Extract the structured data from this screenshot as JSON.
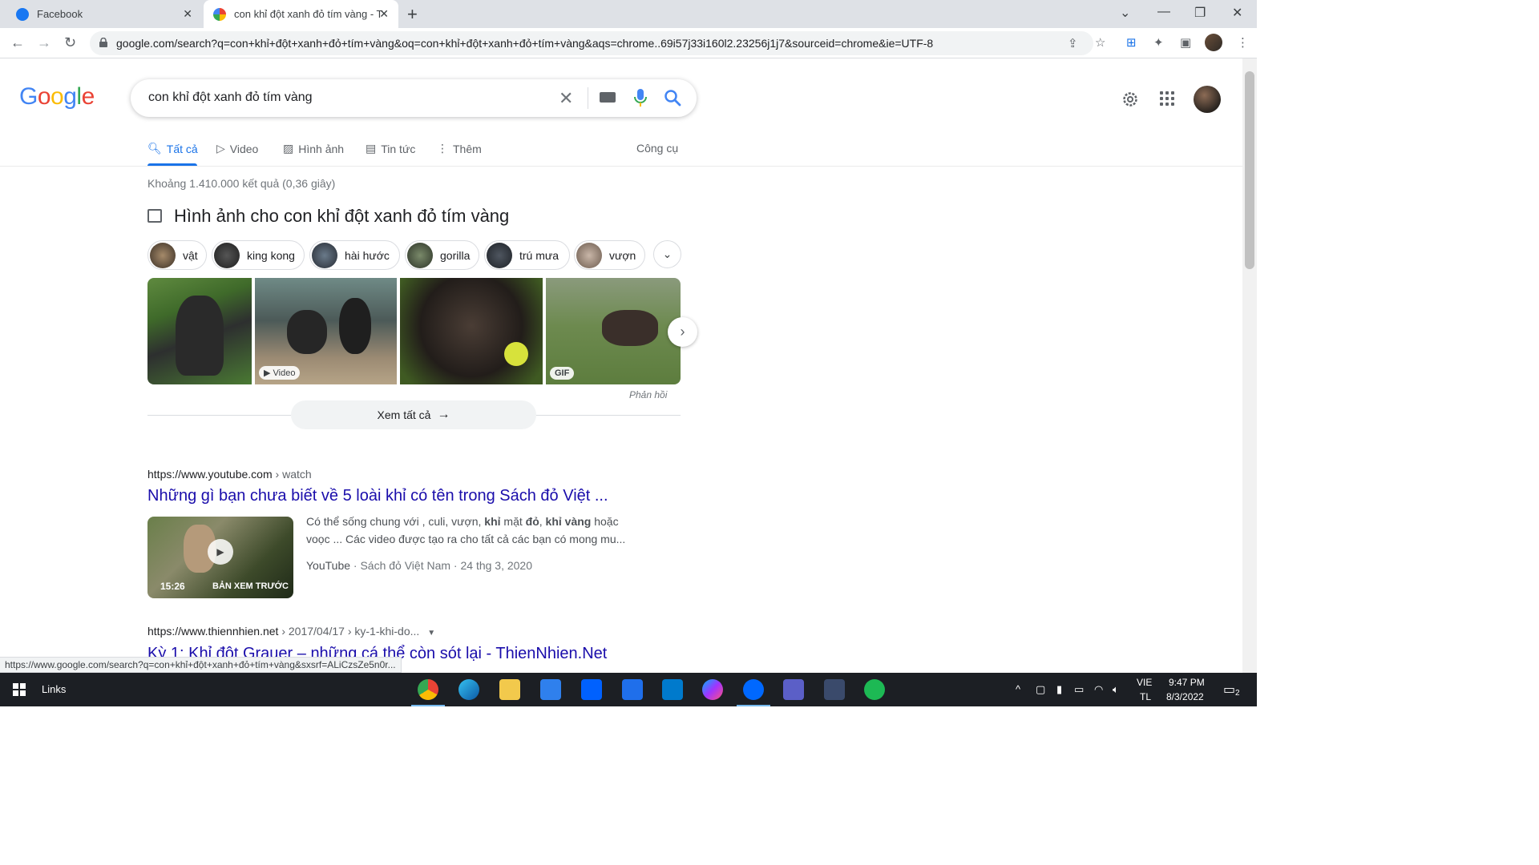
{
  "browser": {
    "tabs": [
      {
        "title": "Facebook",
        "favicon_color": "#1877f2"
      },
      {
        "title": "con khỉ đột xanh đỏ tím vàng - T",
        "favicon_color": "#4285f4"
      }
    ],
    "url": "google.com/search?q=con+khỉ+đột+xanh+đỏ+tím+vàng&oq=con+khỉ+đột+xanh+đỏ+tím+vàng&aqs=chrome..69i57j33i160l2.23256j1j7&sourceid=chrome&ie=UTF-8",
    "status_url": "https://www.google.com/search?q=con+khỉ+đột+xanh+đỏ+tím+vàng&sxsrf=ALiCzsZe5n0r..."
  },
  "google": {
    "logo": [
      "G",
      "o",
      "o",
      "g",
      "l",
      "e"
    ],
    "query": "con khỉ đột xanh đỏ tím vàng",
    "nav_tabs": [
      "Tất cả",
      "Video",
      "Hình ảnh",
      "Tin tức",
      "Thêm"
    ],
    "tools": "Công cụ",
    "stats": "Khoảng 1.410.000 kết quả (0,36 giây)",
    "images_header": "Hình ảnh cho con khỉ đột xanh đỏ tím vàng",
    "chips": [
      "vật",
      "king kong",
      "hài hước",
      "gorilla",
      "trú mưa",
      "vượn"
    ],
    "image_badges": {
      "video": "Video",
      "gif": "GIF"
    },
    "feedback": "Phản hồi",
    "see_all": "Xem tất cả"
  },
  "results": [
    {
      "cite_domain": "https://www.youtube.com",
      "cite_path": " › watch",
      "title": "Những gì bạn chưa biết về 5 loài khỉ có tên trong Sách đỏ Việt ...",
      "snippet_line1_a": "Có thể sống chung với , culi, vượn, ",
      "snippet_b1": "khỉ",
      "snippet_line1_c": " mặt ",
      "snippet_b2": "đỏ",
      "snippet_line1_d": ", ",
      "snippet_b3": "khỉ vàng",
      "snippet_line1_e": " hoặc",
      "snippet_line2": "voọc ... Các video được tạo ra cho tất cả các bạn có mong mu...",
      "video_duration": "15:26",
      "video_preview": "BẢN XEM TRƯỚC",
      "source": "YouTube",
      "meta": " · Sách đỏ Việt Nam · 24 thg 3, 2020"
    },
    {
      "cite_domain": "https://www.thiennhien.net",
      "cite_path": " › 2017/04/17 › ky-1-khi-do...",
      "title": "Kỳ 1: Khỉ đột Grauer – những cá thể còn sót lại - ThienNhien.Net"
    }
  ],
  "taskbar": {
    "links": "Links",
    "lang1": "VIE",
    "lang2": "TL",
    "time": "9:47 PM",
    "date": "8/3/2022",
    "notif_count": "2"
  }
}
